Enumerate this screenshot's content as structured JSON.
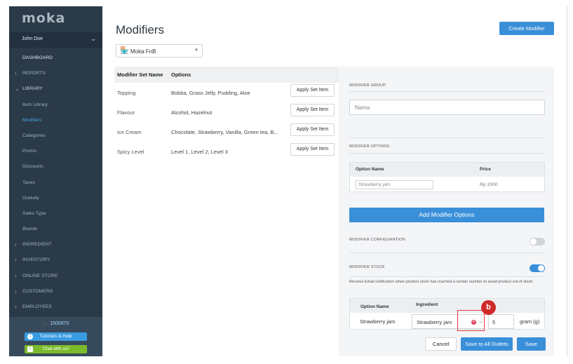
{
  "colors": {
    "sidebar_bg": "#2b3a48",
    "accent": "#3a8fd9",
    "active_nav": "#3fa8e8",
    "chat_green": "#7bbb2b",
    "highlight_red": "#e23b3b"
  },
  "sidebar": {
    "logo": "moka",
    "user_name": "John Doe",
    "items": [
      {
        "label": "DASHBOARD",
        "caret": ""
      },
      {
        "label": "REPORTS",
        "caret": "›"
      },
      {
        "label": "LIBRARY",
        "caret": "⌄"
      },
      {
        "label": "Item Library",
        "caret": ""
      },
      {
        "label": "Modifiers",
        "caret": ""
      },
      {
        "label": "Categories",
        "caret": ""
      },
      {
        "label": "Promo",
        "caret": ""
      },
      {
        "label": "Discounts",
        "caret": ""
      },
      {
        "label": "Taxes",
        "caret": ""
      },
      {
        "label": "Gratuity",
        "caret": ""
      },
      {
        "label": "Sales Type",
        "caret": ""
      },
      {
        "label": "Brands",
        "caret": ""
      },
      {
        "label": "INGREDIENT",
        "caret": "›"
      },
      {
        "label": "INVENTORY",
        "caret": "›"
      },
      {
        "label": "ONLINE STORE",
        "caret": "›"
      },
      {
        "label": "CUSTOMERS",
        "caret": "›"
      },
      {
        "label": "EMPLOYEES",
        "caret": "›"
      }
    ],
    "phone": "1500970",
    "tutorials_label": "Tutorials & Help",
    "chat_label": "Chat with us!"
  },
  "page": {
    "title": "Modifiers",
    "create_button": "Create Modifier",
    "outlet": "Moka FnB"
  },
  "modifier_table": {
    "headers": [
      "Modifier Set Name",
      "Options"
    ],
    "apply_label": "Apply Set Item",
    "rows": [
      {
        "name": "Topping",
        "options": "Bobba, Grass Jelly, Pudding, Aloe"
      },
      {
        "name": "Flavour",
        "options": "Alcohol, Hazelnut"
      },
      {
        "name": "Ice Cream",
        "options": "Chocolate, Strawberry, Vanilla, Green tea, B..."
      },
      {
        "name": "Spicy Level",
        "options": "Level 1, Level 2, Level 3"
      }
    ]
  },
  "panel": {
    "group_label": "MODIFIER GROUP",
    "name_placeholder": "Nama",
    "options_label": "MODIFIER OPTIONS",
    "option_col_name": "Option Name",
    "option_col_price": "Price",
    "option_name_value": "Strawberry jam",
    "option_price": "Rp 2000",
    "add_options_button": "Add Modifier Options",
    "config_label": "MODIFIER CONFIGURATION",
    "config_enabled": false,
    "stock_label": "MODIFIER STOCK",
    "stock_enabled": true,
    "notice": "Receive Email notification when product stock has reached a certain number to avoid product out of stock.",
    "stock_col_option": "Option Name",
    "stock_col_ingredient": "Ingredient",
    "stock_option_name": "Strawberry jam",
    "stock_ingredient": "Strawberry jam",
    "stock_qty": "5",
    "stock_unit": "gram (g)",
    "annotation_badge": "b"
  },
  "footer": {
    "cancel": "Cancel",
    "save_all": "Save to All Outlets",
    "save": "Save"
  }
}
